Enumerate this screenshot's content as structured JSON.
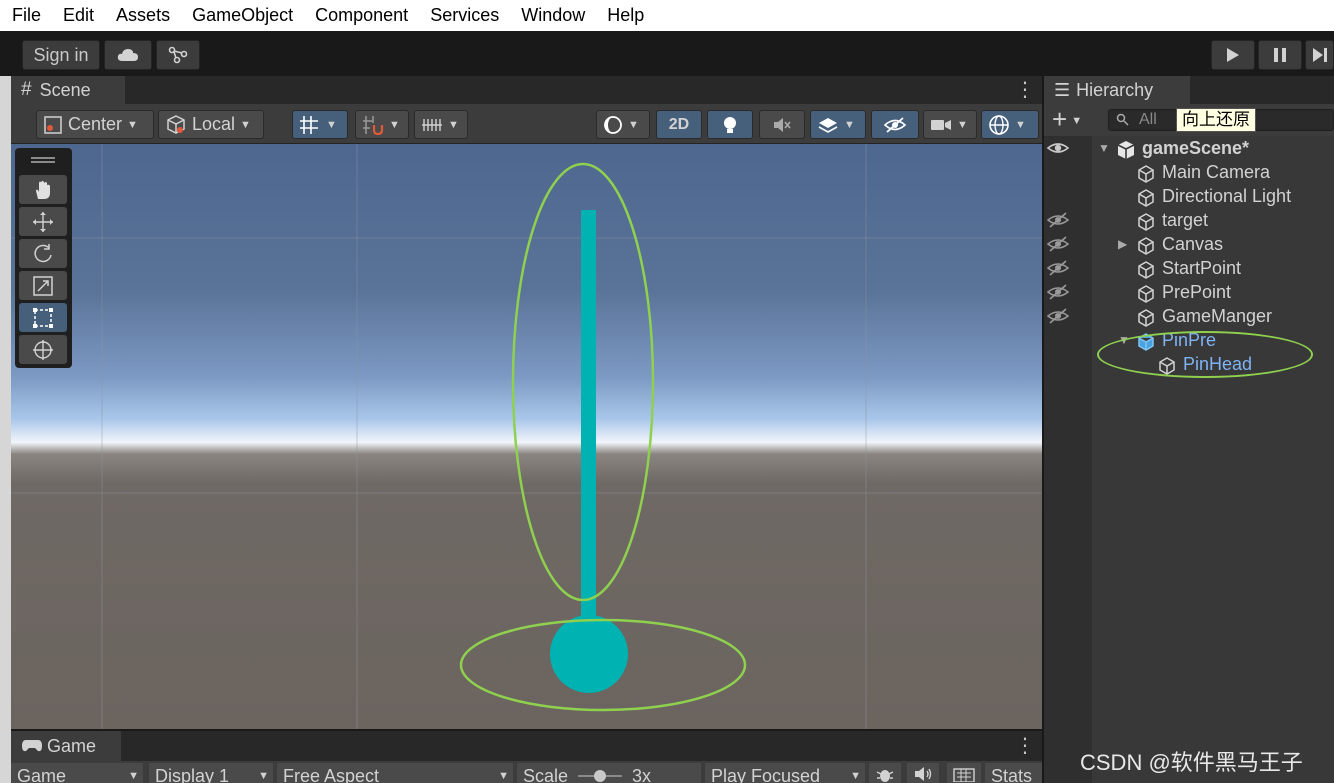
{
  "menu": [
    "File",
    "Edit",
    "Assets",
    "GameObject",
    "Component",
    "Services",
    "Window",
    "Help"
  ],
  "toolbar": {
    "sign_in": "Sign in",
    "cloud_icon": "cloud-icon",
    "collab_icon": "collab-icon",
    "play_icon": "play-icon",
    "pause_icon": "pause-icon",
    "step_icon": "step-icon"
  },
  "scene": {
    "tab_label": "Scene",
    "tab_icon": "grid-hash-icon",
    "pivot_mode": "Center",
    "pivot_rotation": "Local",
    "mode_2d": "2D",
    "object_colors": {
      "pin_body": "#00b2b2",
      "pin_head": "#00b2b2",
      "annotation": "#8fd14f"
    }
  },
  "tools": [
    "hand-tool-icon",
    "move-tool-icon",
    "rotate-tool-icon",
    "scale-tool-icon",
    "rect-tool-icon",
    "transform-tool-icon"
  ],
  "active_tool": "rect-tool-icon",
  "game": {
    "tab_label": "Game",
    "display_mode": "Game",
    "display": "Display 1",
    "aspect": "Free Aspect",
    "scale_label": "Scale",
    "scale_value": "3x",
    "play_mode": "Play Focused",
    "stats": "Stats"
  },
  "hierarchy": {
    "tab_label": "Hierarchy",
    "search_placeholder": "All",
    "tooltip": "向上还原",
    "scene_name": "gameScene*",
    "items": [
      {
        "label": "Main Camera",
        "hidden": false,
        "expandable": false,
        "selected": false
      },
      {
        "label": "Directional Light",
        "hidden": false,
        "expandable": false,
        "selected": false
      },
      {
        "label": "target",
        "hidden": true,
        "expandable": false,
        "selected": false
      },
      {
        "label": "Canvas",
        "hidden": true,
        "expandable": true,
        "selected": false
      },
      {
        "label": "StartPoint",
        "hidden": true,
        "expandable": false,
        "selected": false
      },
      {
        "label": "PrePoint",
        "hidden": true,
        "expandable": false,
        "selected": false
      },
      {
        "label": "GameManger",
        "hidden": true,
        "expandable": false,
        "selected": false
      },
      {
        "label": "PinPre",
        "hidden": false,
        "expandable": true,
        "selected": true
      },
      {
        "label": "PinHead",
        "hidden": false,
        "expandable": false,
        "selected": true
      }
    ]
  },
  "watermark": "CSDN @软件黑马王子"
}
